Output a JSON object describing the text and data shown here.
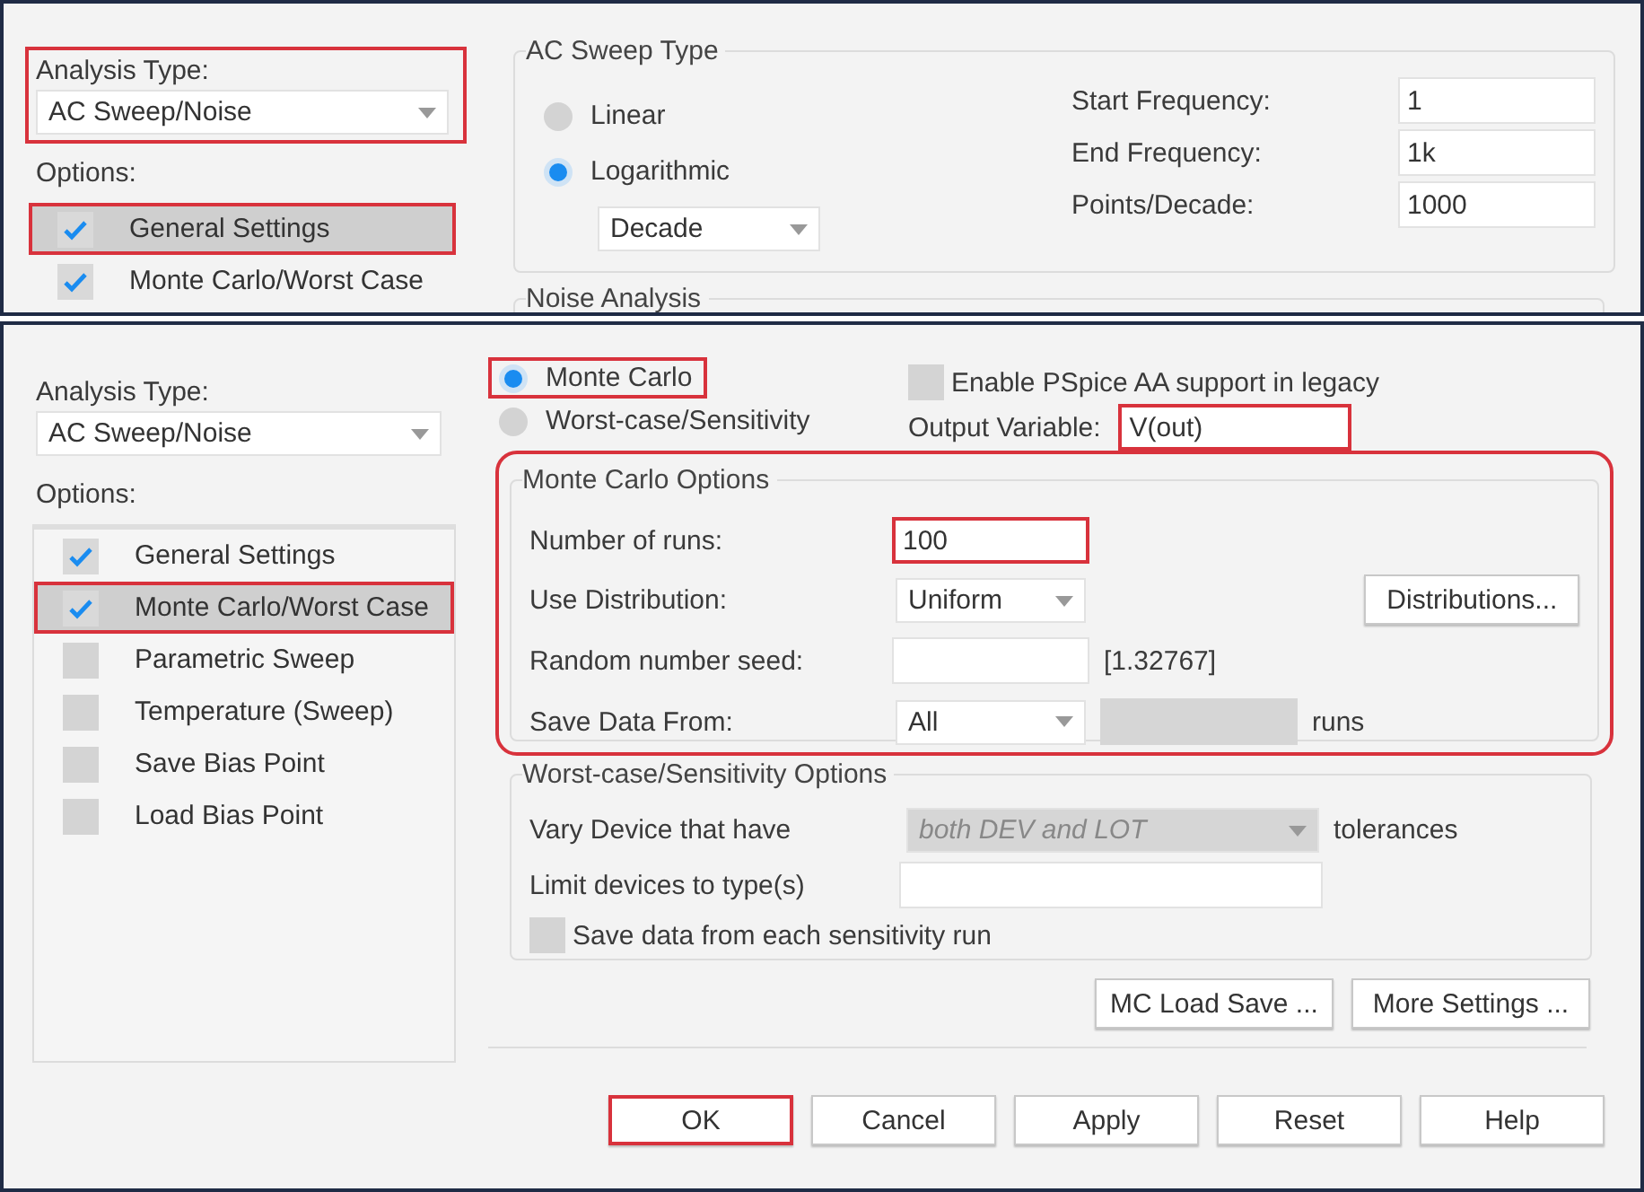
{
  "top_panel": {
    "analysis_type": {
      "label": "Analysis Type:",
      "value": "AC Sweep/Noise",
      "highlighted": true
    },
    "options_label": "Options:",
    "options": [
      {
        "label": "General Settings",
        "checked": true,
        "selected": true,
        "highlighted": true
      },
      {
        "label": "Monte Carlo/Worst Case",
        "checked": true,
        "selected": false,
        "highlighted": false
      }
    ],
    "ac_sweep_type": {
      "title": "AC Sweep Type",
      "radios": [
        {
          "label": "Linear",
          "selected": false
        },
        {
          "label": "Logarithmic",
          "selected": true
        }
      ],
      "scale": "Decade",
      "fields": [
        {
          "label": "Start Frequency:",
          "value": "1"
        },
        {
          "label": "End Frequency:",
          "value": "1k"
        },
        {
          "label": "Points/Decade:",
          "value": "1000"
        }
      ]
    },
    "noise_analysis": {
      "title": "Noise Analysis"
    }
  },
  "bottom_panel": {
    "analysis_type": {
      "label": "Analysis Type:",
      "value": "AC Sweep/Noise",
      "highlighted": false
    },
    "options_label": "Options:",
    "options": [
      {
        "label": "General Settings",
        "checked": true,
        "selected": false,
        "highlighted": false
      },
      {
        "label": "Monte Carlo/Worst Case",
        "checked": true,
        "selected": true,
        "highlighted": true
      },
      {
        "label": "Parametric Sweep",
        "checked": false,
        "selected": false,
        "highlighted": false
      },
      {
        "label": "Temperature (Sweep)",
        "checked": false,
        "selected": false,
        "highlighted": false
      },
      {
        "label": "Save Bias Point",
        "checked": false,
        "selected": false,
        "highlighted": false
      },
      {
        "label": "Load Bias Point",
        "checked": false,
        "selected": false,
        "highlighted": false
      }
    ],
    "mode_radios": [
      {
        "label": "Monte Carlo",
        "selected": true,
        "highlighted": true
      },
      {
        "label": "Worst-case/Sensitivity",
        "selected": false,
        "highlighted": false
      }
    ],
    "enable_aa": {
      "label": "Enable PSpice AA support in legacy",
      "checked": false
    },
    "output_variable": {
      "label": "Output Variable:",
      "value": "V(out)",
      "highlighted": true
    },
    "monte_carlo_options": {
      "title": "Monte Carlo Options",
      "highlighted": true,
      "number_of_runs": {
        "label": "Number of runs:",
        "value": "100",
        "highlighted": true
      },
      "use_distribution": {
        "label": "Use Distribution:",
        "value": "Uniform"
      },
      "distributions_button": "Distributions...",
      "random_seed": {
        "label": "Random number seed:",
        "hint": "[1.32767]"
      },
      "save_data_from": {
        "label": "Save Data From:",
        "value": "All",
        "runs_disabled": true,
        "suffix": "runs"
      }
    },
    "worst_case_options": {
      "title": "Worst-case/Sensitivity Options",
      "vary_device": {
        "label": "Vary Device that have",
        "value": "both DEV and LOT",
        "disabled": true,
        "suffix": "tolerances"
      },
      "limit_devices": {
        "label": "Limit devices to type(s)"
      },
      "save_each_run": {
        "label": "Save data from each sensitivity run",
        "checked": false
      }
    },
    "side_buttons": [
      "MC Load Save ...",
      "More Settings ..."
    ],
    "dialog_buttons": [
      {
        "label": "OK",
        "highlighted": true
      },
      {
        "label": "Cancel",
        "highlighted": false
      },
      {
        "label": "Apply",
        "highlighted": false
      },
      {
        "label": "Reset",
        "highlighted": false
      },
      {
        "label": "Help",
        "highlighted": false
      }
    ]
  }
}
